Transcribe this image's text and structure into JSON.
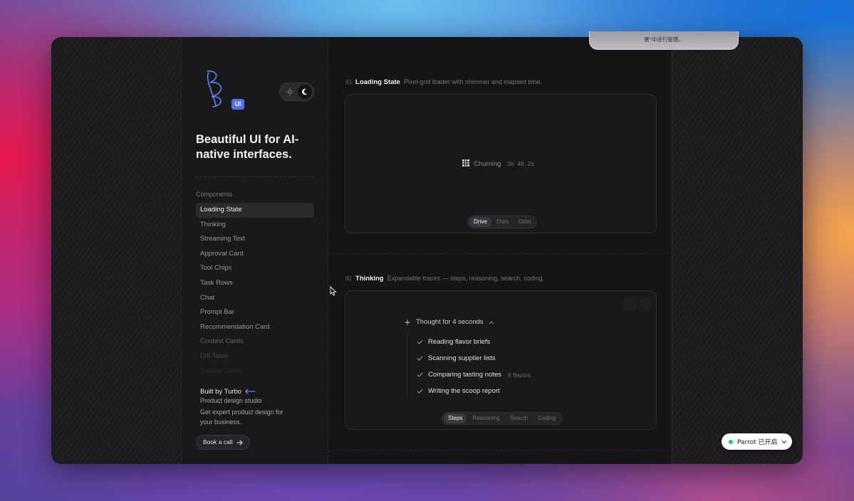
{
  "brand": {
    "badge": "UI"
  },
  "sidebar": {
    "tagline": "Beautiful UI for AI-native interfaces.",
    "components_heading": "Components",
    "items": [
      {
        "label": "Loading State"
      },
      {
        "label": "Thinking"
      },
      {
        "label": "Streaming Text"
      },
      {
        "label": "Approval Card"
      },
      {
        "label": "Tool Chips"
      },
      {
        "label": "Task Rows"
      },
      {
        "label": "Chat"
      },
      {
        "label": "Prompt Bar"
      },
      {
        "label": "Recommendation Card"
      },
      {
        "label": "Context Cards"
      },
      {
        "label": "Diff Table"
      },
      {
        "label": "Source Cards"
      }
    ],
    "active_item": "Loading State",
    "promo": {
      "title": "Built by Turbo",
      "subtitle": "Product design studio",
      "description": "Get expert product design for your business.",
      "button": "Book a call"
    }
  },
  "sections": [
    {
      "num": "01",
      "title": "Loading State",
      "desc": "Pixel-grid loader with shimmer and elapsed time.",
      "loader_label": "Churning",
      "elapsed": "3m 40.2s",
      "variants": [
        "Drive",
        "Dots",
        "Orbit"
      ],
      "selected_variant": "Drive"
    },
    {
      "num": "02",
      "title": "Thinking",
      "desc": "Expandable traces — steps, reasoning, search, coding.",
      "thought_title": "Thought for 4 seconds",
      "steps": [
        {
          "label": "Reading flavor briefs",
          "note": ""
        },
        {
          "label": "Scanning supplier lists",
          "note": ""
        },
        {
          "label": "Comparing tasting notes",
          "note": "6 flavors"
        },
        {
          "label": "Writing the scoop report",
          "note": ""
        }
      ],
      "tabs": [
        "Steps",
        "Reasoning",
        "Search",
        "Coding"
      ],
      "selected_tab": "Steps"
    }
  ],
  "overlay": {
    "tooltip_text": "置\"中进行管理。",
    "parrot_label": "Parrot 已开启",
    "parrot_status_color": "#22c55e"
  },
  "colors": {
    "accent": "#4f72e8",
    "window_bg": "#151517"
  }
}
